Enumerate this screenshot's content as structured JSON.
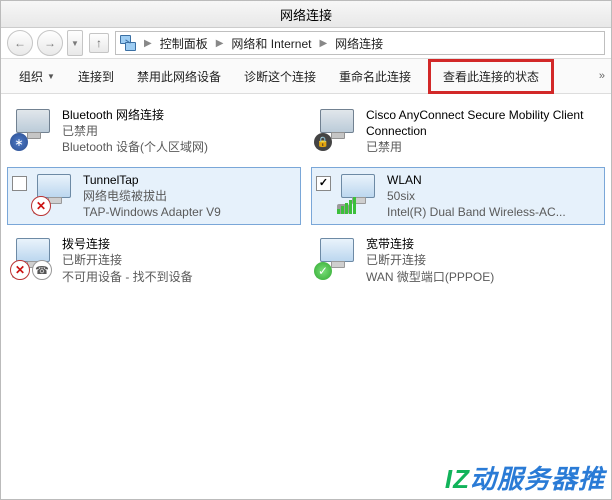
{
  "window_title": "网络连接",
  "breadcrumb": {
    "segments": [
      "控制面板",
      "网络和 Internet",
      "网络连接"
    ]
  },
  "toolbar": {
    "organize": "组织",
    "connect_to": "连接到",
    "disable_device": "禁用此网络设备",
    "diagnose": "诊断这个连接",
    "rename": "重命名此连接",
    "view_status": "查看此连接的状态",
    "more": "»"
  },
  "connections": [
    {
      "name": "Bluetooth 网络连接",
      "status": "已禁用",
      "detail": "Bluetooth 设备(个人区域网)",
      "overlay": "bt",
      "checkbox": false,
      "selected": false,
      "checked": false
    },
    {
      "name": "Cisco AnyConnect Secure Mobility Client Connection",
      "status": "已禁用",
      "detail": "",
      "overlay": "lock",
      "checkbox": false,
      "selected": false,
      "checked": false
    },
    {
      "name": "TunnelTap",
      "status": "网络电缆被拔出",
      "detail": "TAP-Windows Adapter V9",
      "overlay": "x",
      "checkbox": true,
      "selected": true,
      "checked": false
    },
    {
      "name": "WLAN",
      "status": "50six",
      "detail": "Intel(R) Dual Band Wireless-AC...",
      "overlay": "bars",
      "checkbox": true,
      "selected": true,
      "checked": true
    },
    {
      "name": "拨号连接",
      "status": "已断开连接",
      "detail": "不可用设备 - 找不到设备",
      "overlay": "x",
      "with_phone": true,
      "checkbox": false,
      "selected": false,
      "checked": false
    },
    {
      "name": "宽带连接",
      "status": "已断开连接",
      "detail": "WAN 微型端口(PPPOE)",
      "overlay": "ok",
      "checkbox": false,
      "selected": false,
      "checked": false
    }
  ],
  "watermark": {
    "text1": "IZ",
    "text2": "动服务器推"
  }
}
